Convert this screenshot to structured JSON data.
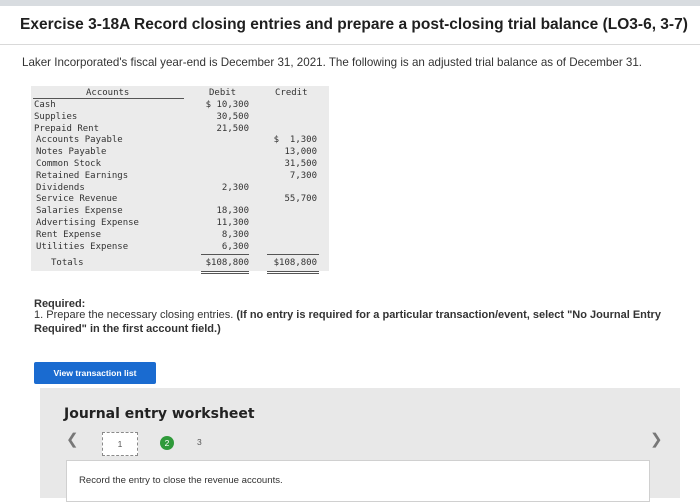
{
  "exercise": {
    "title": "Exercise 3-18A Record closing entries and prepare a post-closing trial balance (LO3-6, 3-7)",
    "intro": "Laker Incorporated's fiscal year-end is December 31, 2021. The following is an adjusted trial balance as of December 31."
  },
  "trial_balance": {
    "headers": {
      "accounts": "Accounts",
      "debit": "Debit",
      "credit": "Credit"
    },
    "rows": [
      {
        "account": "Cash",
        "debit": "$ 10,300",
        "credit": ""
      },
      {
        "account": "Supplies",
        "debit": "30,500",
        "credit": ""
      },
      {
        "account": "Prepaid Rent",
        "debit": "21,500",
        "credit": ""
      },
      {
        "account": "Accounts Payable",
        "debit": "",
        "credit": "$  1,300"
      },
      {
        "account": "Notes Payable",
        "debit": "",
        "credit": "13,000"
      },
      {
        "account": "Common Stock",
        "debit": "",
        "credit": "31,500"
      },
      {
        "account": "Retained Earnings",
        "debit": "",
        "credit": "7,300"
      },
      {
        "account": "Dividends",
        "debit": "2,300",
        "credit": ""
      },
      {
        "account": "Service Revenue",
        "debit": "",
        "credit": "55,700"
      },
      {
        "account": "Salaries Expense",
        "debit": "18,300",
        "credit": ""
      },
      {
        "account": "Advertising Expense",
        "debit": "11,300",
        "credit": ""
      },
      {
        "account": "Rent Expense",
        "debit": "8,300",
        "credit": ""
      },
      {
        "account": "Utilities Expense",
        "debit": "6,300",
        "credit": ""
      }
    ],
    "totals": {
      "label": "Totals",
      "debit": "$108,800",
      "credit": "$108,800"
    }
  },
  "required": {
    "heading": "Required:",
    "instruction": "1. Prepare the necessary closing entries.",
    "note": "(If no entry is required for a particular transaction/event, select \"No Journal Entry Required\" in the first account field.)"
  },
  "buttons": {
    "view_transaction_list": "View transaction list"
  },
  "worksheet": {
    "title": "Journal entry worksheet",
    "steps": [
      "1",
      "2",
      "3"
    ],
    "entry_instruction": "Record the entry to close the revenue accounts."
  }
}
